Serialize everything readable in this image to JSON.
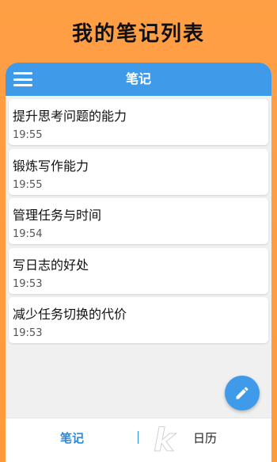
{
  "headline": "我的笔记列表",
  "appbar": {
    "title": "笔记",
    "menu_icon": "hamburger-menu-icon"
  },
  "notes": [
    {
      "title": "提升思考问题的能力",
      "time": "19:55"
    },
    {
      "title": "锻炼写作能力",
      "time": "19:55"
    },
    {
      "title": "管理任务与时间",
      "time": "19:54"
    },
    {
      "title": "写日志的好处",
      "time": "19:53"
    },
    {
      "title": "减少任务切换的代价",
      "time": "19:53"
    }
  ],
  "fab": {
    "icon": "edit-pencil-icon"
  },
  "tabs": [
    {
      "label": "笔记",
      "active": true
    },
    {
      "label": "日历",
      "active": false
    }
  ],
  "colors": {
    "accent": "#3f9be9",
    "background": "#ff9f45"
  }
}
